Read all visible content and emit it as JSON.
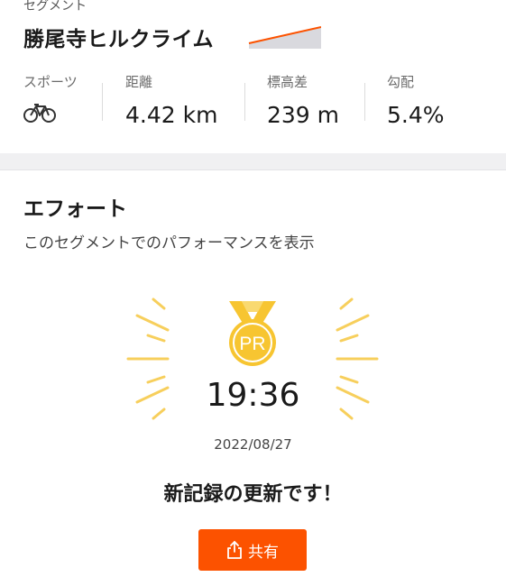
{
  "segment": {
    "section_label": "セグメント",
    "title": "勝尾寺ヒルクライム",
    "elevation_thumb_color": "#fc5200",
    "stats": [
      {
        "label": "スポーツ",
        "icon": "bike-icon"
      },
      {
        "label": "距離",
        "value": "4.42 km"
      },
      {
        "label": "標高差",
        "value": "239 m"
      },
      {
        "label": "勾配",
        "value": "5.4%"
      }
    ]
  },
  "effort": {
    "title": "エフォート",
    "subtitle": "このセグメントでのパフォーマンスを表示",
    "medal_text": "PR",
    "medal_color": "#f7c531",
    "time": "19:36",
    "date": "2022/08/27",
    "record_text": "新記録の更新です！",
    "share_label": "共有",
    "share_color": "#fc5200"
  }
}
